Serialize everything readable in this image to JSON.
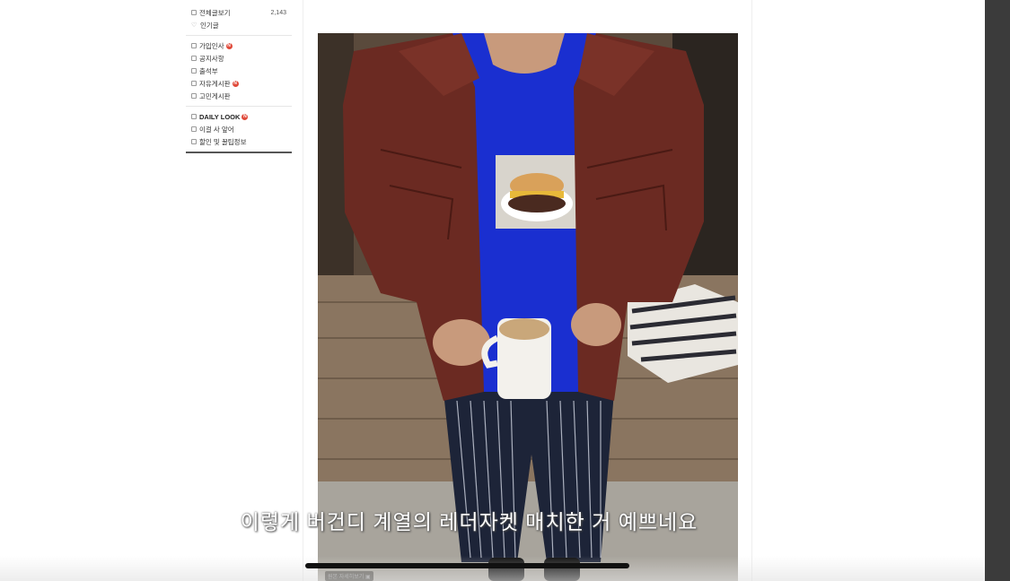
{
  "sidebar": {
    "top_items": [
      {
        "label": "전체글보기",
        "count": "2,143",
        "icon": "board-icon"
      },
      {
        "label": "인기글",
        "icon": "heart-icon"
      }
    ],
    "board_items": [
      {
        "label": "가입인사",
        "new": true
      },
      {
        "label": "공지사항",
        "new": false
      },
      {
        "label": "출석부",
        "new": false
      },
      {
        "label": "자유게시판",
        "new": true
      },
      {
        "label": "고민게시판",
        "new": false
      }
    ],
    "style_items": [
      {
        "label": "DAILY LOOK",
        "new": true
      },
      {
        "label": "이걸 사 앞어",
        "new": false
      },
      {
        "label": "할인 및 꿀팁정보",
        "new": false
      }
    ],
    "new_badge": "N"
  },
  "photo": {
    "caption": "원본 자세히보기 ▣"
  },
  "subtitle": "이렇게 버건디 계열의 레더자켓 매치한 거 예쁘네요",
  "colors": {
    "jacket": "#6b2a22",
    "shirt": "#1a2fd0",
    "pants": "#1d2438",
    "new_badge": "#e04a3a"
  }
}
